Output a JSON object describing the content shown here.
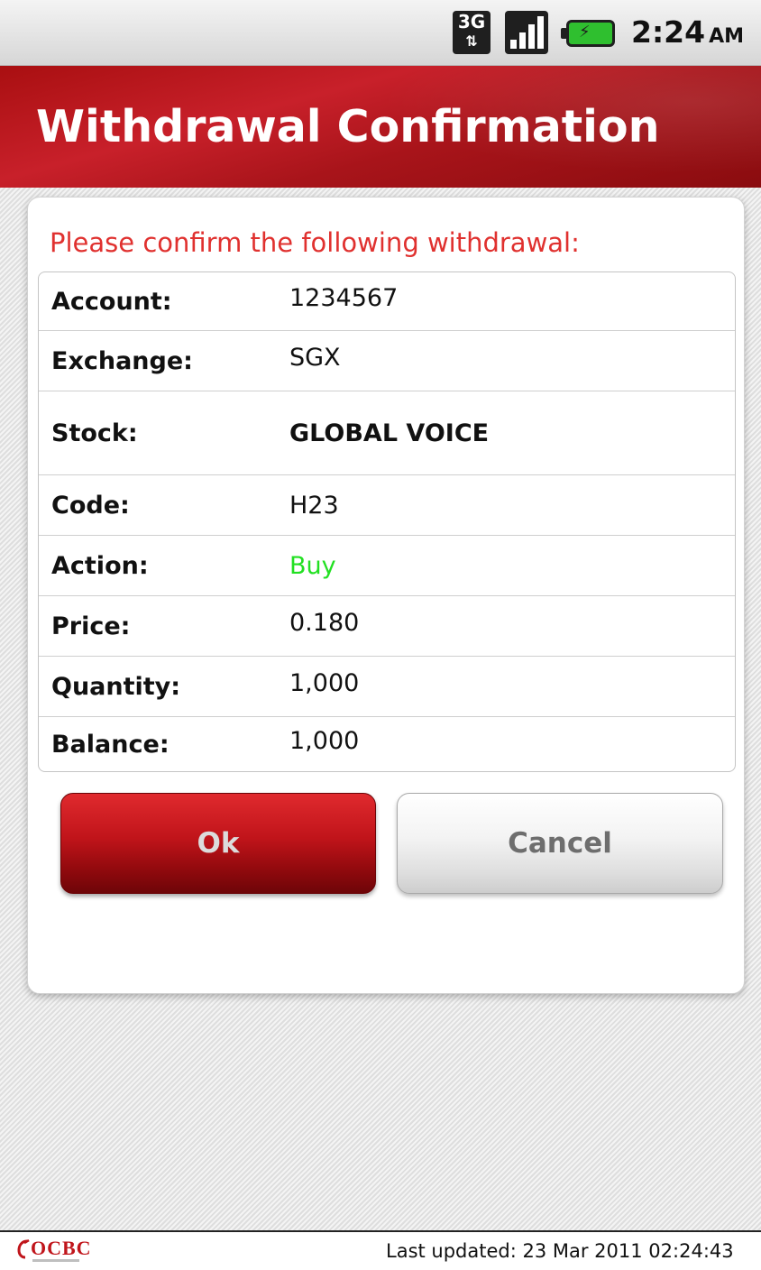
{
  "status_bar": {
    "network_label": "3G",
    "time": "2:24",
    "ampm": "AM",
    "icons": [
      "3g-data-icon",
      "signal-strength-icon",
      "battery-charging-icon"
    ]
  },
  "header": {
    "title": "Withdrawal Confirmation"
  },
  "dialog": {
    "prompt": "Please confirm the following withdrawal:",
    "rows": [
      {
        "label": "Account:",
        "value": "1234567"
      },
      {
        "label": "Exchange:",
        "value": "SGX"
      },
      {
        "label": "Stock:",
        "value": "GLOBAL VOICE"
      },
      {
        "label": "Code:",
        "value": "H23"
      },
      {
        "label": "Action:",
        "value": "Buy"
      },
      {
        "label": "Price:",
        "value": "0.180"
      },
      {
        "label": "Quantity:",
        "value": "1,000"
      },
      {
        "label": "Balance:",
        "value": "1,000"
      }
    ],
    "ok_label": "Ok",
    "cancel_label": "Cancel"
  },
  "footer": {
    "logo_text": "OCBC",
    "last_updated": "Last updated: 23 Mar 2011 02:24:43"
  },
  "colors": {
    "brand_red": "#c0151b",
    "prompt_red": "#e0312f",
    "buy_green": "#22e022"
  }
}
